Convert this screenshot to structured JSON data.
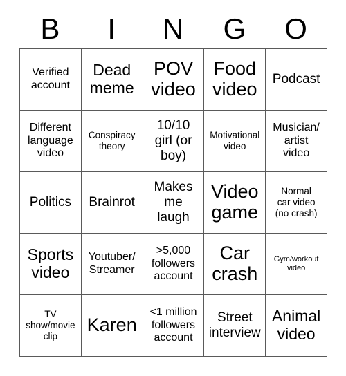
{
  "card": {
    "header_letters": [
      "B",
      "I",
      "N",
      "G",
      "O"
    ],
    "rows": [
      [
        {
          "text": "Verified\naccount",
          "size": "fs-md"
        },
        {
          "text": "Dead\nmeme",
          "size": "fs-xl"
        },
        {
          "text": "POV\nvideo",
          "size": "fs-xxl"
        },
        {
          "text": "Food\nvideo",
          "size": "fs-xxl"
        },
        {
          "text": "Podcast",
          "size": "fs-lg"
        }
      ],
      [
        {
          "text": "Different\nlanguage\nvideo",
          "size": "fs-md"
        },
        {
          "text": "Conspiracy\ntheory",
          "size": "fs-sm"
        },
        {
          "text": "10/10\ngirl (or\nboy)",
          "size": "fs-lg"
        },
        {
          "text": "Motivational\nvideo",
          "size": "fs-sm"
        },
        {
          "text": "Musician/\nartist\nvideo",
          "size": "fs-md"
        }
      ],
      [
        {
          "text": "Politics",
          "size": "fs-lg"
        },
        {
          "text": "Brainrot",
          "size": "fs-lg"
        },
        {
          "text": "Makes\nme\nlaugh",
          "size": "fs-lg"
        },
        {
          "text": "Video\ngame",
          "size": "fs-xxl"
        },
        {
          "text": "Normal\ncar video\n(no crash)",
          "size": "fs-sm"
        }
      ],
      [
        {
          "text": "Sports\nvideo",
          "size": "fs-xl"
        },
        {
          "text": "Youtuber/\nStreamer",
          "size": "fs-md"
        },
        {
          "text": ">5,000\nfollowers\naccount",
          "size": "fs-md"
        },
        {
          "text": "Car\ncrash",
          "size": "fs-xxl"
        },
        {
          "text": "Gym/workout\nvideo",
          "size": "fs-xs"
        }
      ],
      [
        {
          "text": "TV\nshow/movie\nclip",
          "size": "fs-sm"
        },
        {
          "text": "Karen",
          "size": "fs-xxl"
        },
        {
          "text": "<1 million\nfollowers\naccount",
          "size": "fs-md"
        },
        {
          "text": "Street\ninterview",
          "size": "fs-lg"
        },
        {
          "text": "Animal\nvideo",
          "size": "fs-xl"
        }
      ]
    ]
  },
  "colors": {
    "border": "#5a5a5a",
    "text": "#000000",
    "background": "#ffffff"
  }
}
